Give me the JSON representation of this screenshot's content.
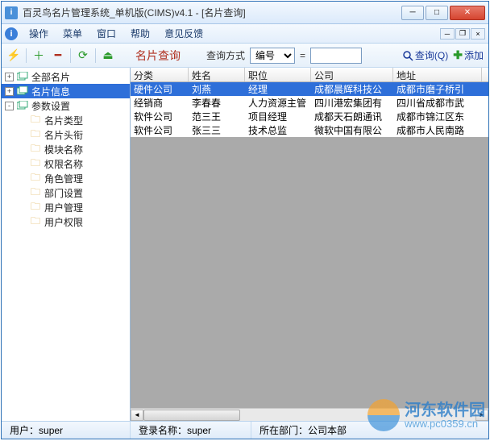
{
  "window": {
    "title": "百灵鸟名片管理系统_单机版(CIMS)v4.1 - [名片查询]",
    "controls": {
      "min": "─",
      "max": "□",
      "close": "✕"
    }
  },
  "menubar": {
    "items": [
      "操作",
      "菜单",
      "窗口",
      "帮助",
      "意见反馈"
    ],
    "mdi": {
      "min": "─",
      "restore": "❐",
      "close": "×"
    }
  },
  "sidebar_toolbar": {
    "bolt": "⚡",
    "add": "＋",
    "remove": "━",
    "refresh": "⟳",
    "exit": "⏏"
  },
  "tree": {
    "roots": [
      {
        "label": "全部名片",
        "exp": "+"
      },
      {
        "label": "名片信息",
        "exp": "+",
        "selected": true
      },
      {
        "label": "参数设置",
        "exp": "-",
        "children": [
          {
            "label": "名片类型"
          },
          {
            "label": "名片头衔"
          },
          {
            "label": "模块名称"
          },
          {
            "label": "权限名称"
          },
          {
            "label": "角色管理"
          },
          {
            "label": "部门设置"
          },
          {
            "label": "用户管理"
          },
          {
            "label": "用户权限"
          }
        ]
      }
    ]
  },
  "query": {
    "panel_title": "名片查询",
    "mode_label": "查询方式",
    "mode_value": "编号",
    "eq": "=",
    "search_label": "查询(Q)",
    "add_label": "添加"
  },
  "grid": {
    "columns": [
      "分类",
      "姓名",
      "职位",
      "公司",
      "地址"
    ],
    "rows": [
      {
        "cells": [
          "硬件公司",
          "刘燕",
          "经理",
          "成都晨辉科技公",
          "成都市磨子桥引"
        ],
        "selected": true
      },
      {
        "cells": [
          "经销商",
          "李春春",
          "人力资源主管",
          "四川港宏集团有",
          "四川省成都市武"
        ]
      },
      {
        "cells": [
          "软件公司",
          "范三王",
          "项目经理",
          "成都天石朗通讯",
          "成都市锦江区东"
        ]
      },
      {
        "cells": [
          "软件公司",
          "张三三",
          "技术总监",
          "微软中国有限公",
          "成都市人民南路"
        ]
      }
    ]
  },
  "statusbar": {
    "user_label": "用户：",
    "user_value": "super",
    "login_label": "登录名称：",
    "login_value": "super",
    "dept_label": "所在部门：",
    "dept_value": "公司本部"
  },
  "watermark": {
    "line1": "河东软件园",
    "line2": "www.pc0359.cn"
  }
}
